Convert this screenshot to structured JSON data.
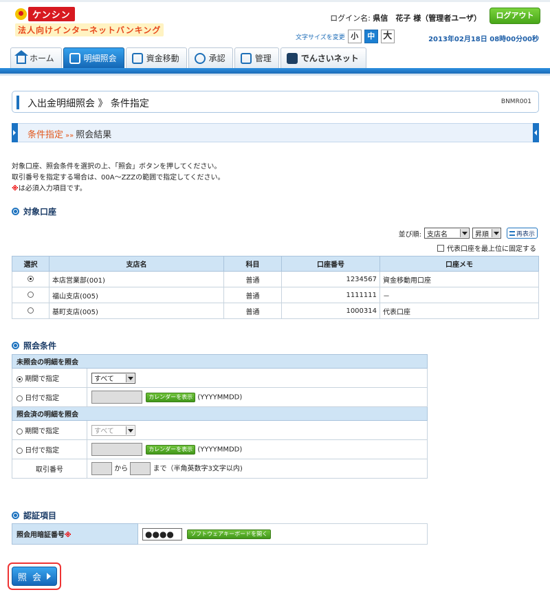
{
  "header": {
    "logo_name": "ケンシン",
    "logo_sub": "法人向けインターネットバンキング",
    "login_label": "ログイン名:",
    "login_name": "県信　花子 様（管理者ユーザ）",
    "logout": "ログアウト",
    "fontsize_label": "文字サイズを変更",
    "fontsize_small": "小",
    "fontsize_medium": "中",
    "fontsize_large": "大",
    "datetime": "2013年02月18日 08時00分00秒"
  },
  "nav": [
    {
      "label": "ホーム",
      "icon": "home-icon"
    },
    {
      "label": "明細照会",
      "icon": "statement-icon"
    },
    {
      "label": "資金移動",
      "icon": "transfer-icon"
    },
    {
      "label": "承認",
      "icon": "check-icon"
    },
    {
      "label": "管理",
      "icon": "user-admin-icon"
    },
    {
      "label": "でんさいネット",
      "icon": "densai-icon"
    }
  ],
  "page": {
    "title": "入出金明細照会 》 条件指定",
    "screen_id": "BNMR001",
    "step_current": "条件指定",
    "step_sep": "»»",
    "step_next": "照会結果",
    "instr1": "対象口座、照会条件を選択の上、「照会」ボタンを押してください。",
    "instr2": "取引番号を指定する場合は、00A～ZZZの範囲で指定してください。",
    "instr_req_mark": "※",
    "instr3": "は必須入力項目です。"
  },
  "accounts": {
    "heading": "対象口座",
    "sort_label": "並び順:",
    "sort_key": "支店名",
    "sort_order": "昇順",
    "redisplay": "再表示",
    "fix_label": "代表口座を最上位に固定する",
    "columns": [
      "選択",
      "支店名",
      "科目",
      "口座番号",
      "口座メモ"
    ],
    "rows": [
      {
        "branch": "本店営業部(001)",
        "type": "普通",
        "number": "1234567",
        "memo": "資金移動用口座"
      },
      {
        "branch": "福山支店(005)",
        "type": "普通",
        "number": "1111111",
        "memo": "－"
      },
      {
        "branch": "基町支店(005)",
        "type": "普通",
        "number": "1000314",
        "memo": "代表口座"
      }
    ]
  },
  "conditions": {
    "heading": "照会条件",
    "unref_head": "未照会の明細を照会",
    "ref_head": "照会済の明細を照会",
    "period_label": "期間で指定",
    "date_label": "日付で指定",
    "period_value": "すべて",
    "calendar_btn": "カレンダーを表示",
    "date_format": "(YYYYMMDD)",
    "txn_label": "取引番号",
    "txn_from": "から",
    "txn_to": "まで（半角英数字3文字以内)"
  },
  "auth": {
    "heading": "認証項目",
    "pw_label": "照会用暗証番号",
    "req_mark": "※",
    "pw_value": "●●●●",
    "keyboard_btn": "ソフトウェアキーボードを開く"
  },
  "submit": "照 会"
}
